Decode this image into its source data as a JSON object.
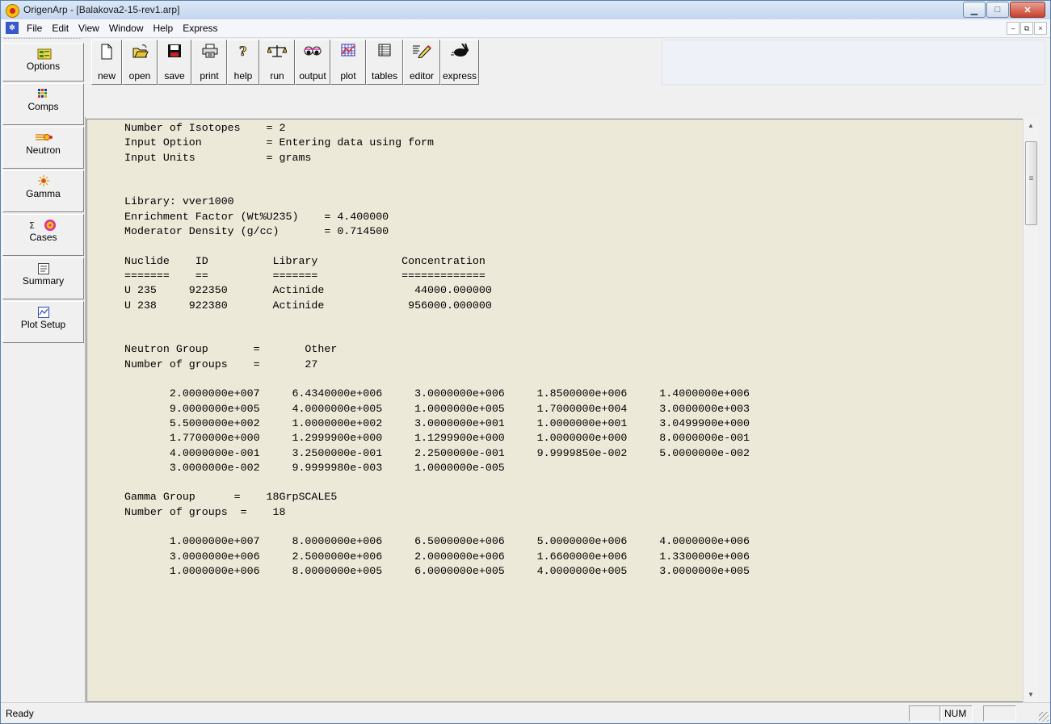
{
  "window": {
    "title": "OrigenArp - [Balakova2-15-rev1.arp]",
    "min_label": "▁",
    "max_label": "□",
    "close_label": "✕"
  },
  "menu": {
    "items": [
      {
        "label": "File"
      },
      {
        "label": "Edit"
      },
      {
        "label": "View"
      },
      {
        "label": "Window"
      },
      {
        "label": "Help"
      },
      {
        "label": "Express"
      }
    ],
    "mdi_min": "–",
    "mdi_restore": "⧉",
    "mdi_close": "×"
  },
  "sidebar": {
    "items": [
      {
        "label": "Options",
        "icon": "options-icon"
      },
      {
        "label": "Comps",
        "icon": "comps-icon"
      },
      {
        "label": "Neutron",
        "icon": "neutron-icon"
      },
      {
        "label": "Gamma",
        "icon": "gamma-icon"
      },
      {
        "label": "Cases",
        "icon": "cases-icon"
      },
      {
        "label": "Summary",
        "icon": "summary-icon"
      },
      {
        "label": "Plot Setup",
        "icon": "plot-setup-icon"
      }
    ]
  },
  "toolbar": {
    "buttons": [
      {
        "label": "new"
      },
      {
        "label": "open"
      },
      {
        "label": "save"
      },
      {
        "label": "print"
      },
      {
        "label": "help"
      },
      {
        "label": "run"
      },
      {
        "label": "output"
      },
      {
        "label": "plot"
      },
      {
        "label": "tables"
      },
      {
        "label": "editor"
      },
      {
        "label": "express"
      }
    ]
  },
  "content": {
    "lines": [
      "Number of Isotopes    = 2",
      "Input Option          = Entering data using form",
      "Input Units           = grams",
      "",
      "",
      "Library: vver1000",
      "Enrichment Factor (Wt%U235)    = 4.400000",
      "Moderator Density (g/cc)       = 0.714500",
      "",
      "Nuclide    ID          Library             Concentration",
      "=======    ==          =======             =============",
      "U 235     922350       Actinide              44000.000000",
      "U 238     922380       Actinide             956000.000000",
      "",
      "",
      "Neutron Group       =       Other",
      "Number of groups    =       27",
      "",
      "       2.0000000e+007     6.4340000e+006     3.0000000e+006     1.8500000e+006     1.4000000e+006",
      "       9.0000000e+005     4.0000000e+005     1.0000000e+005     1.7000000e+004     3.0000000e+003",
      "       5.5000000e+002     1.0000000e+002     3.0000000e+001     1.0000000e+001     3.0499900e+000",
      "       1.7700000e+000     1.2999900e+000     1.1299900e+000     1.0000000e+000     8.0000000e-001",
      "       4.0000000e-001     3.2500000e-001     2.2500000e-001     9.9999850e-002     5.0000000e-002",
      "       3.0000000e-002     9.9999980e-003     1.0000000e-005",
      "",
      "Gamma Group      =    18GrpSCALE5",
      "Number of groups  =    18",
      "",
      "       1.0000000e+007     8.0000000e+006     6.5000000e+006     5.0000000e+006     4.0000000e+006",
      "       3.0000000e+006     2.5000000e+006     2.0000000e+006     1.6600000e+006     1.3300000e+006",
      "       1.0000000e+006     8.0000000e+005     6.0000000e+005     4.0000000e+005     3.0000000e+005"
    ]
  },
  "status": {
    "text": "Ready",
    "num": "NUM"
  }
}
